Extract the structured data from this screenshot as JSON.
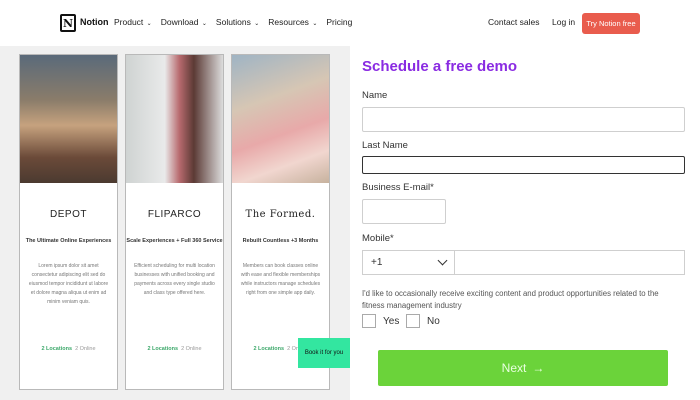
{
  "nav": {
    "brand": "Notion",
    "menu": [
      {
        "label": "Product",
        "caret": "⌄"
      },
      {
        "label": "Download",
        "caret": "⌄"
      },
      {
        "label": "Solutions",
        "caret": "⌄"
      },
      {
        "label": "Resources",
        "caret": "⌄"
      },
      {
        "label": "Pricing",
        "caret": ""
      }
    ],
    "contact": "Contact sales",
    "login": "Log in",
    "cta": "Try Notion free",
    "cta_color": "#e95c4d"
  },
  "cards": [
    {
      "name": "DEPOT",
      "subtitle": "The Ultimate Online Experiences",
      "description": "Lorem ipsum dolor sit amet consectetur adipiscing elit sed do eiusmod tempor incididunt ut labore et dolore magna aliqua ut enim ad minim veniam quis.",
      "stat": "2 Locations",
      "stat_extra": "2 Online"
    },
    {
      "name": "FLIPARCO",
      "subtitle": "Scale Experiences + Full 360 Service",
      "description": "Efficient scheduling for multi location businesses with unified booking and payments across every single studio and class type offered here.",
      "stat": "2 Locations",
      "stat_extra": "2 Online"
    },
    {
      "name": "The Formed.",
      "subtitle": "Rebuilt Countless +3 Months",
      "description": "Members can book classes online with ease and flexible memberships while instructors manage schedules right from one simple app daily.",
      "stat": "2 Locations",
      "stat_extra": "2 Online"
    }
  ],
  "floating_tab": "Book it for you",
  "form": {
    "title": "Schedule a free demo",
    "title_color": "#8a2be2",
    "name_label": "Name",
    "last_name_label": "Last Name",
    "email_label": "Business E-mail*",
    "mobile_label": "Mobile*",
    "country_code": "+1",
    "consent": "I'd like to occasionally receive exciting content and product opportunities related to the fitness management industry",
    "yes": "Yes",
    "no": "No",
    "next": "Next",
    "next_arrow": "→",
    "next_color": "#6bd33a"
  }
}
